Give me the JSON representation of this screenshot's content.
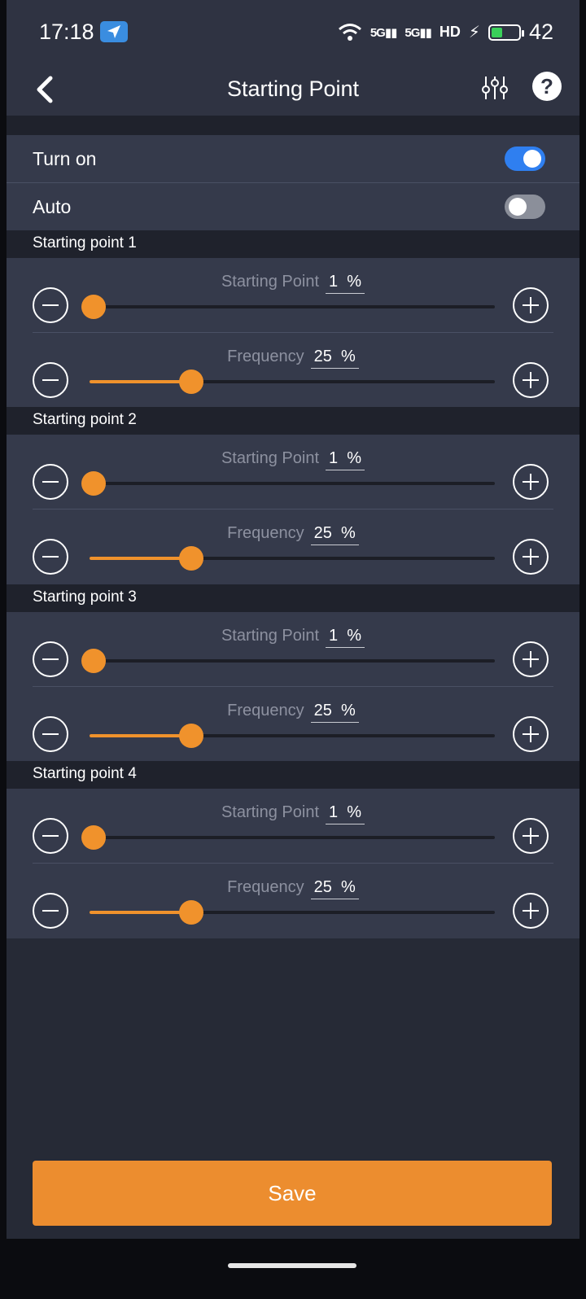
{
  "status_bar": {
    "time": "17:18",
    "signal_1": "5G",
    "signal_2": "5G",
    "hd": "HD",
    "battery": "42"
  },
  "header": {
    "title": "Starting Point"
  },
  "toggles": {
    "turn_on": {
      "label": "Turn on",
      "state": "on"
    },
    "auto": {
      "label": "Auto",
      "state": "off"
    }
  },
  "sections": [
    {
      "title": "Starting point 1",
      "start": {
        "label": "Starting Point",
        "value": "1",
        "unit": "%"
      },
      "freq": {
        "label": "Frequency",
        "value": "25",
        "unit": "%"
      }
    },
    {
      "title": "Starting point 2",
      "start": {
        "label": "Starting Point",
        "value": "1",
        "unit": "%"
      },
      "freq": {
        "label": "Frequency",
        "value": "25",
        "unit": "%"
      }
    },
    {
      "title": "Starting point 3",
      "start": {
        "label": "Starting Point",
        "value": "1",
        "unit": "%"
      },
      "freq": {
        "label": "Frequency",
        "value": "25",
        "unit": "%"
      }
    },
    {
      "title": "Starting point 4",
      "start": {
        "label": "Starting Point",
        "value": "1",
        "unit": "%"
      },
      "freq": {
        "label": "Frequency",
        "value": "25",
        "unit": "%"
      }
    }
  ],
  "save_label": "Save",
  "colors": {
    "accent": "#f0922c",
    "toggle_on": "#2f7ff0",
    "background": "#262a36"
  }
}
